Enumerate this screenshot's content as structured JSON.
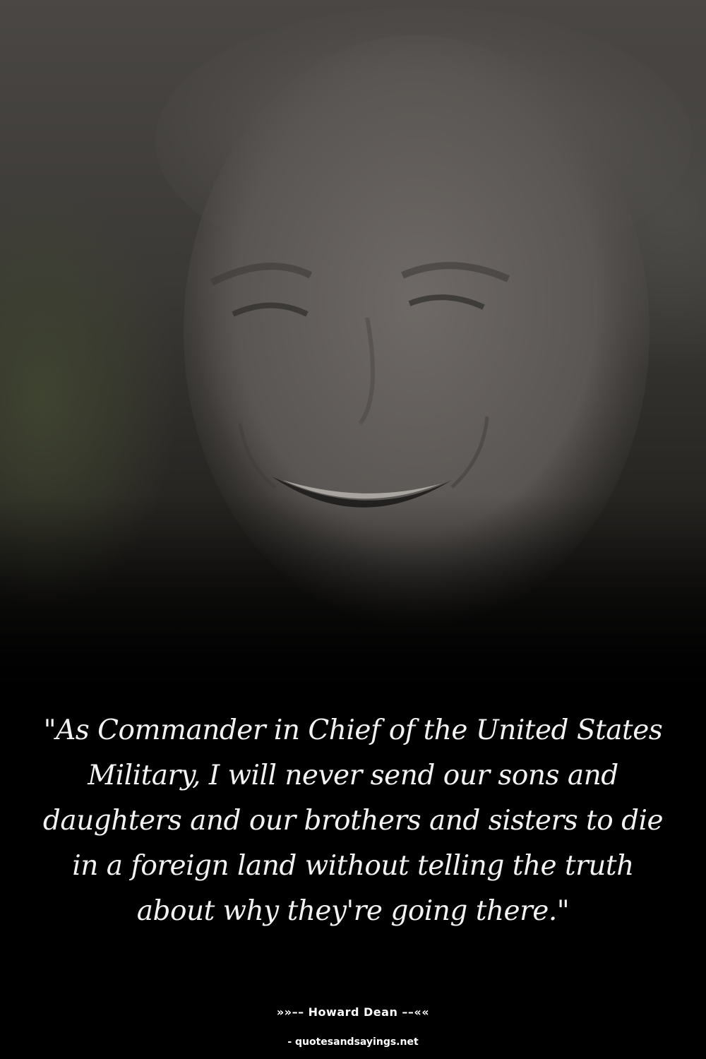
{
  "quote": {
    "text": "\"As Commander in Chief of the United States Military, I will never send our sons and daughters and our brothers and sisters to die in a foreign land without telling the truth about why they're going there.\""
  },
  "attribution": {
    "text": "»»–– Howard Dean ––««"
  },
  "watermark": {
    "text": "- quotesandsayings.net"
  },
  "colors": {
    "background": "#000000",
    "text": "#f2f2f2"
  }
}
